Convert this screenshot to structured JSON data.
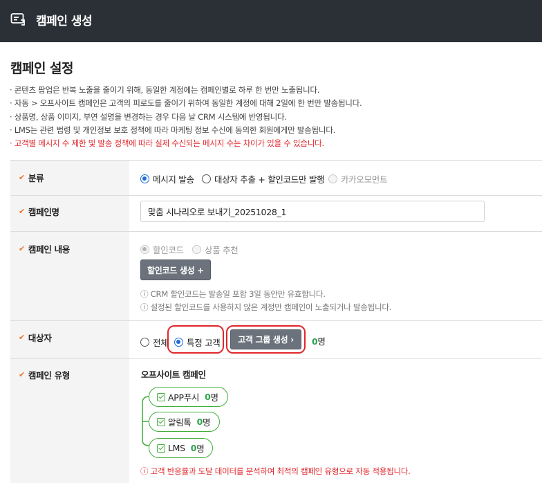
{
  "header": {
    "title": "캠페인 생성"
  },
  "page": {
    "title": "캠페인 설정"
  },
  "notices": [
    "· 콘텐츠 팝업은 반복 노출을 줄이기 위해, 동일한 계정에는 캠페인별로 하루 한 번만 노출됩니다.",
    "· 자동 > 오프사이트 캠페인은 고객의 피로도를 줄이기 위하여 동일한 계정에 대해 2일에 한 번만 발송됩니다.",
    "· 상품명, 상품 이미지, 부연 설명을 변경하는 경우 다음 날 CRM 시스템에 반영됩니다.",
    "· LMS는 관련 법령 및 개인정보 보호 정책에 따라 마케팅 정보 수신에 동의한 회원에게만 발송됩니다."
  ],
  "notice_warning": "· 고객별 메시지 수 제한 및 발송 정책에 따라 실제 수신되는 메시지 수는 차이가 있을 수 있습니다.",
  "category": {
    "label": "분류",
    "options": [
      "메시지 발송",
      "대상자 추출 + 할인코드만 발행",
      "카카오모먼트"
    ],
    "selected": 0
  },
  "campaign_name": {
    "label": "캠페인명",
    "value": "맞춤 시나리오로 보내기_20251028_1"
  },
  "campaign_content": {
    "label": "캠페인 내용",
    "options": [
      "할인코드",
      "상품 추천"
    ],
    "button": "할인코드 생성 +",
    "info": [
      "ⓘ CRM 할인코드는 발송일 포함 3일 동안만 유효합니다.",
      "ⓘ 설정된 할인코드를 사용하지 않은 계정만 캠페인이 노출되거나 발송됩니다."
    ]
  },
  "target": {
    "label": "대상자",
    "options": [
      "전체",
      "특정 고객"
    ],
    "selected": 1,
    "button": "고객 그룹 생성 ›",
    "count": "0",
    "unit": "명"
  },
  "campaign_type": {
    "label": "캠페인 유형",
    "title": "오프사이트 캠페인",
    "channels": [
      {
        "name": "APP푸시",
        "count": "0",
        "unit": "명"
      },
      {
        "name": "알림톡",
        "count": "0",
        "unit": "명"
      },
      {
        "name": "LMS",
        "count": "0",
        "unit": "명"
      }
    ],
    "warning": "ⓘ 고객 반응률과 도달 데이터를 분석하여 최적의 캠페인 유형으로 자동 적용됩니다."
  },
  "colors": {
    "header_bg": "#2b2f36",
    "accent_orange": "#f27423",
    "highlight_red": "#e0262b",
    "green": "#3fae3a",
    "radio_blue": "#1e6ed8"
  }
}
